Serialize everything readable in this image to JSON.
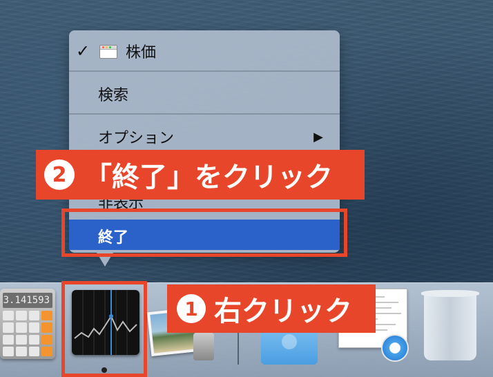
{
  "context_menu": {
    "items": {
      "stock_window": "株価",
      "search": "検索",
      "options": "オプション",
      "hide": "非表示",
      "quit": "終了"
    },
    "options_arrow": "▶",
    "check_mark": "✓"
  },
  "annotations": {
    "step2": {
      "number": "2",
      "text": "「終了」をクリック"
    },
    "step1": {
      "number": "1",
      "text": "右クリック"
    }
  },
  "dock": {
    "calculator_display": "3.141593",
    "icons": [
      "calculator-icon",
      "stocks-icon",
      "photos-icon",
      "downloads-folder-icon",
      "document-icon",
      "safari-icon",
      "trash-icon"
    ]
  },
  "colors": {
    "annotation": "#e8462a",
    "selection": "#2a62c9",
    "menu_bg": "#a8b6c8"
  }
}
